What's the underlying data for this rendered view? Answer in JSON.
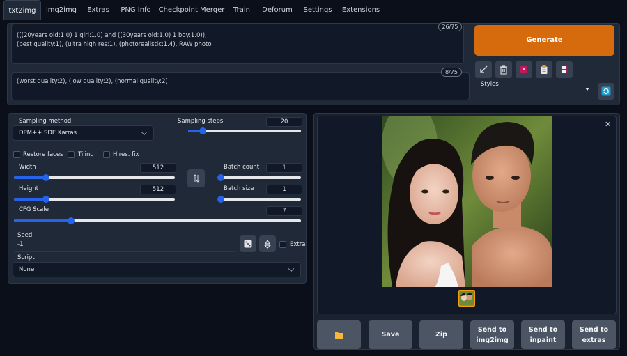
{
  "tabs": [
    "txt2img",
    "img2img",
    "Extras",
    "PNG Info",
    "Checkpoint Merger",
    "Train",
    "Deforum",
    "Settings",
    "Extensions"
  ],
  "prompt": {
    "positive": "(((20years old:1.0) 1 girl:1.0) and ((30years old:1.0) 1 boy:1.0)),\n(best quality:1), (ultra high res:1), (photorealistic:1.4), RAW photo",
    "positive_count": "26/75",
    "negative": "(worst quality:2), (low quality:2), (normal quality:2)",
    "negative_count": "8/75"
  },
  "generate_label": "Generate",
  "styles": {
    "label": "Styles",
    "value": ""
  },
  "sampling": {
    "method_label": "Sampling method",
    "method_value": "DPM++ SDE Karras",
    "steps_label": "Sampling steps",
    "steps_value": "20",
    "steps_fraction": 0.13
  },
  "options": {
    "restore_faces": "Restore faces",
    "tiling": "Tiling",
    "hires_fix": "Hires. fix"
  },
  "width": {
    "label": "Width",
    "value": "512",
    "fraction": 0.2
  },
  "height": {
    "label": "Height",
    "value": "512",
    "fraction": 0.2
  },
  "batch_count": {
    "label": "Batch count",
    "value": "1",
    "fraction": 0.0
  },
  "batch_size": {
    "label": "Batch size",
    "value": "1",
    "fraction": 0.0
  },
  "cfg": {
    "label": "CFG Scale",
    "value": "7",
    "fraction": 0.2
  },
  "seed": {
    "label": "Seed",
    "value": "-1",
    "extra_label": "Extra"
  },
  "script": {
    "label": "Script",
    "value": "None"
  },
  "output_buttons": {
    "folder": "folder-icon",
    "save": "Save",
    "zip": "Zip",
    "send_img2img": "Send to\nimg2img",
    "send_inpaint": "Send to\ninpaint",
    "send_extras": "Send to\nextras"
  },
  "colors": {
    "accent": "#d56b0c",
    "slider": "#2563eb",
    "background": "#0b0f19",
    "panel": "#1f2937"
  }
}
